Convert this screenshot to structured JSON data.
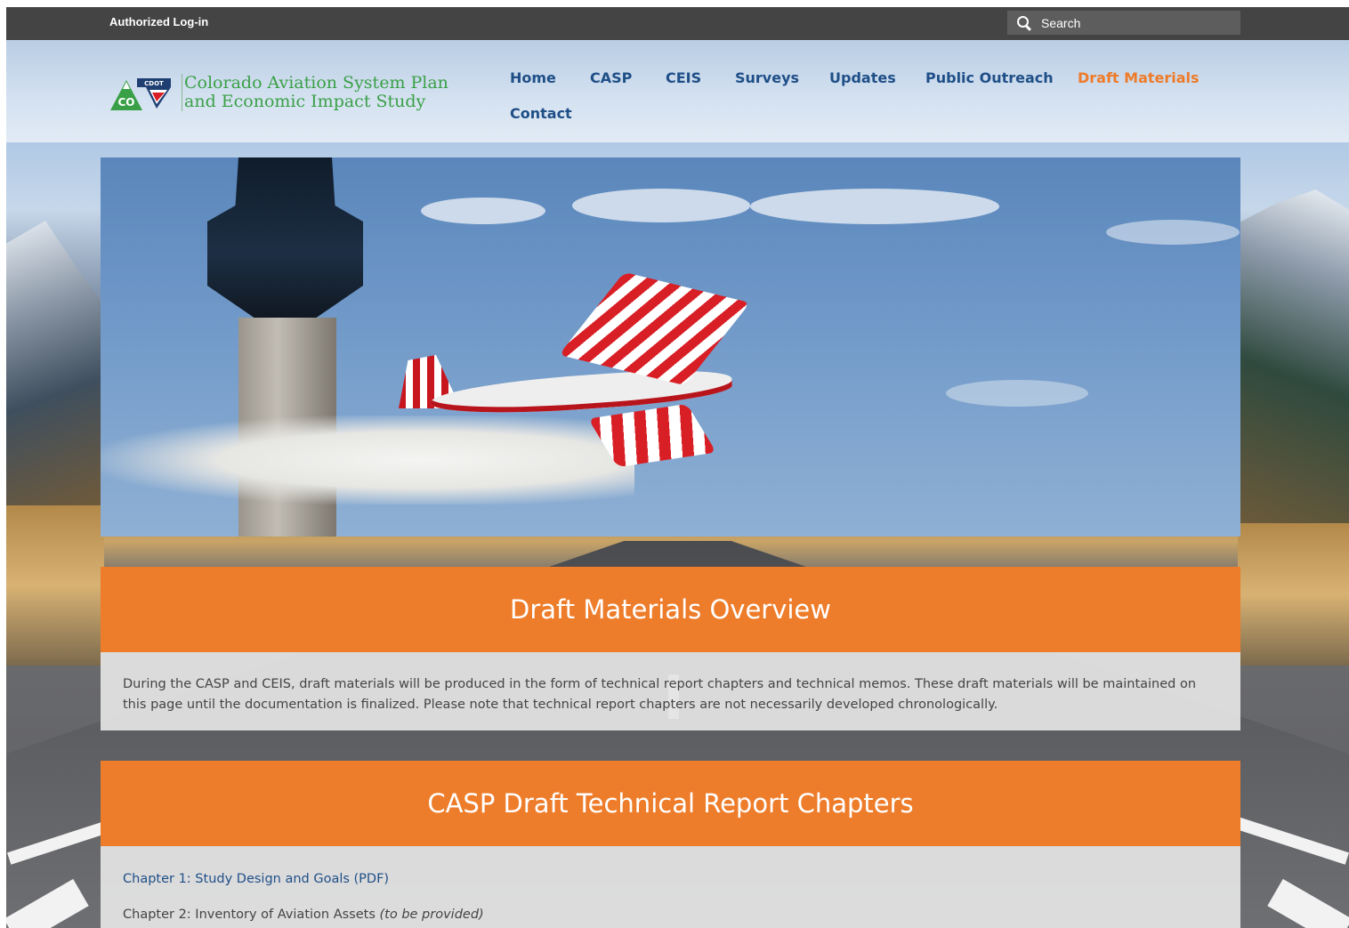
{
  "topbar": {
    "login_label": "Authorized Log-in",
    "search_placeholder": "Search"
  },
  "branding": {
    "logo_badge_top": "CDOT",
    "logo_badge_state": "CO",
    "title_line1": "Colorado Aviation System Plan",
    "title_line2": "and Economic Impact Study",
    "green": "#3aa047"
  },
  "nav": {
    "items": [
      "Home",
      "CASP",
      "CEIS",
      "Surveys",
      "Updates",
      "Public Outreach",
      "Draft Materials",
      "Contact"
    ],
    "active": "Draft Materials",
    "link_color": "#1f4f87",
    "active_color": "#ee7b29"
  },
  "overview": {
    "heading": "Draft Materials Overview",
    "body": "During the CASP and CEIS, draft materials will be produced in the form of technical report chapters and technical memos. These draft materials will be maintained on this page until the documentation is finalized. Please note that technical report chapters are not necessarily developed chronologically."
  },
  "chapters": {
    "heading": "CASP Draft Technical Report Chapters",
    "chapter1": "Chapter 1: Study Design and Goals (PDF)",
    "chapter2": "Chapter 2: Inventory of Aviation Assets",
    "chapter2_note": "(to be provided)"
  },
  "colors": {
    "accent_orange": "#ee7d2b",
    "topbar": "#444444"
  }
}
